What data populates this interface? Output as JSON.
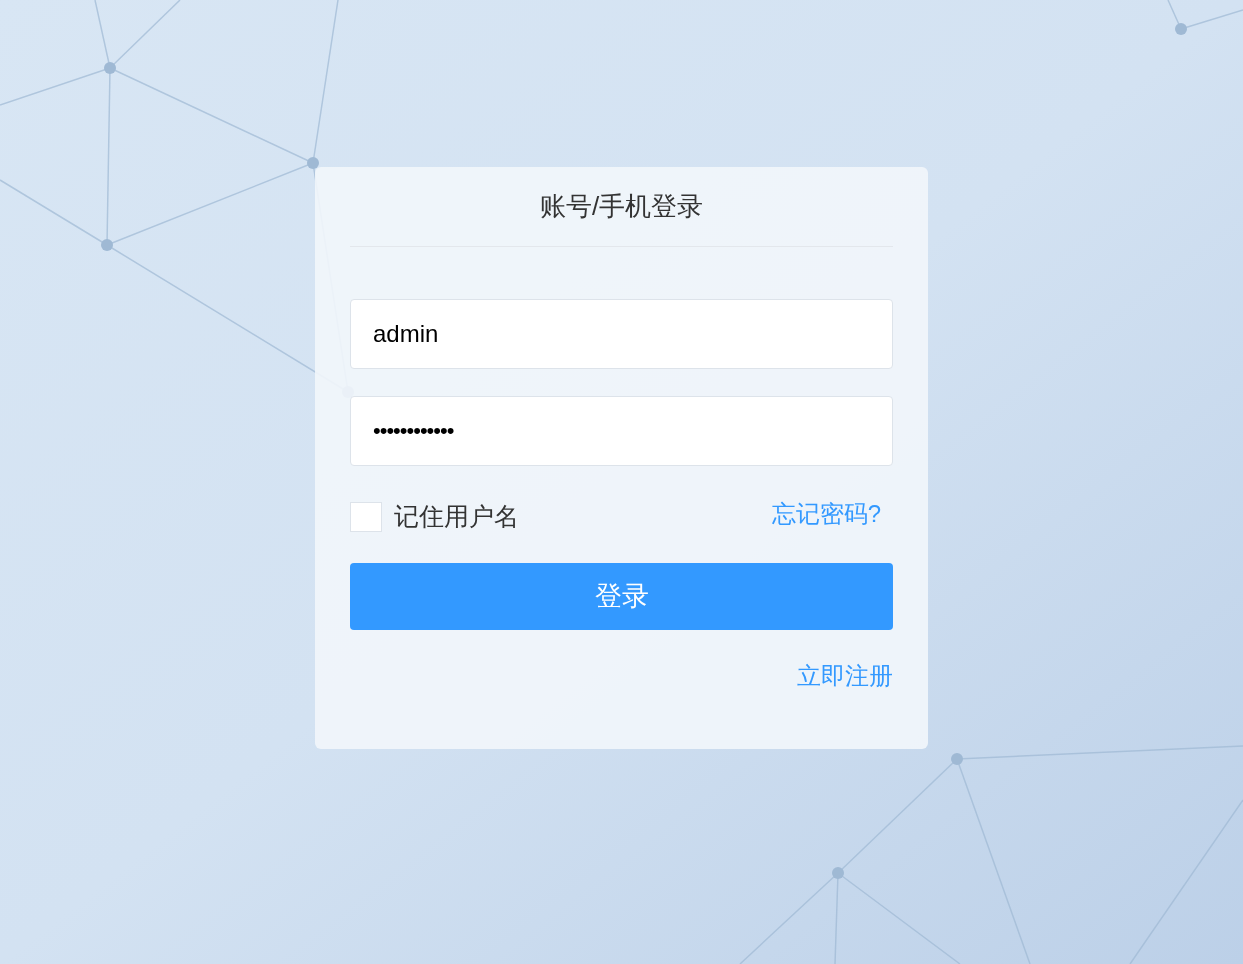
{
  "login": {
    "title": "账号/手机登录",
    "username": {
      "value": "admin"
    },
    "password": {
      "value": "••••••••••••"
    },
    "remember": {
      "label": "记住用户名",
      "checked": false
    },
    "forgot_link": "忘记密码?",
    "submit": "登录",
    "register_link": "立即注册"
  }
}
